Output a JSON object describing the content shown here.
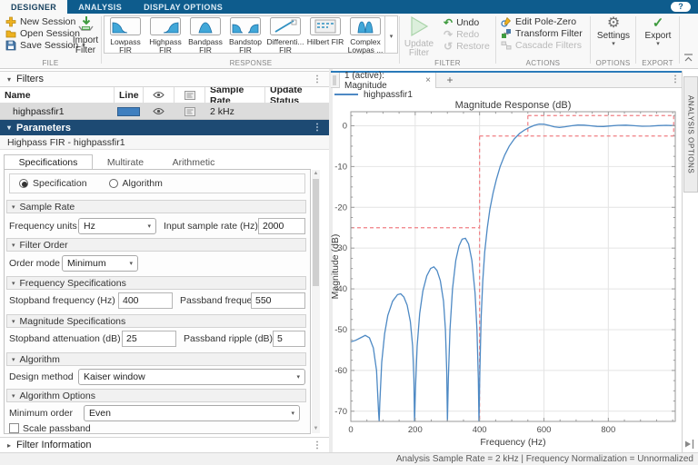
{
  "app": {
    "help_label": "?"
  },
  "menu_tabs": {
    "items": [
      "DESIGNER",
      "ANALYSIS",
      "DISPLAY OPTIONS"
    ],
    "active": "DESIGNER"
  },
  "ribbon": {
    "file": {
      "group_label": "FILE",
      "new_session": "New Session",
      "open_session": "Open Session",
      "save_session": "Save Session",
      "import_line1": "Import",
      "import_line2": "Filter"
    },
    "response": {
      "group_label": "RESPONSE",
      "items": [
        {
          "line1": "Lowpass",
          "line2": "FIR"
        },
        {
          "line1": "Highpass",
          "line2": "FIR"
        },
        {
          "line1": "Bandpass",
          "line2": "FIR"
        },
        {
          "line1": "Bandstop",
          "line2": "FIR"
        },
        {
          "line1": "Differenti...",
          "line2": "FIR"
        },
        {
          "line1": "Hilbert FIR",
          "line2": ""
        },
        {
          "line1": "Complex",
          "line2": "Lowpas ..."
        }
      ]
    },
    "filter": {
      "group_label": "FILTER",
      "update_line1": "Update",
      "update_line2": "Filter",
      "undo": "Undo",
      "redo": "Redo",
      "restore": "Restore"
    },
    "actions": {
      "group_label": "ACTIONS",
      "edit_pole_zero": "Edit Pole-Zero",
      "transform_filter": "Transform Filter",
      "cascade_filters": "Cascade Filters"
    },
    "options": {
      "group_label": "OPTIONS",
      "settings": "Settings"
    },
    "export": {
      "group_label": "EXPORT",
      "export": "Export"
    }
  },
  "filters_panel": {
    "title": "Filters",
    "columns": {
      "name": "Name",
      "line": "Line",
      "sample_rate": "Sample Rate",
      "update_status": "Update Status"
    },
    "row": {
      "name": "highpassfir1",
      "line_color": "#3f7fbf",
      "sample_rate": "2 kHz",
      "update_status": ""
    }
  },
  "parameters_panel": {
    "title": "Parameters",
    "subtitle": "Highpass FIR - highpassfir1",
    "tabs": [
      "Specifications",
      "Multirate",
      "Arithmetic"
    ],
    "active_tab": "Specifications",
    "design_radio": {
      "options": [
        "Specification",
        "Algorithm"
      ],
      "selected": "Specification"
    },
    "sample_rate": {
      "title": "Sample Rate",
      "frequency_units_label": "Frequency units",
      "frequency_units_value": "Hz",
      "input_sample_rate_label": "Input sample rate (Hz)",
      "input_sample_rate_value": "2000"
    },
    "filter_order": {
      "title": "Filter Order",
      "order_mode_label": "Order mode",
      "order_mode_value": "Minimum"
    },
    "frequency_specifications": {
      "title": "Frequency Specifications",
      "stopband_label": "Stopband frequency (Hz)",
      "stopband_value": "400",
      "passband_label": "Passband frequency (Hz)",
      "passband_value": "550"
    },
    "magnitude_specifications": {
      "title": "Magnitude Specifications",
      "stopband_attenuation_label": "Stopband attenuation (dB)",
      "stopband_attenuation_value": "25",
      "passband_ripple_label": "Passband ripple (dB)",
      "passband_ripple_value": "5"
    },
    "algorithm": {
      "title": "Algorithm",
      "design_method_label": "Design method",
      "design_method_value": "Kaiser window"
    },
    "algorithm_options": {
      "title": "Algorithm Options",
      "minimum_order_label": "Minimum order",
      "minimum_order_value": "Even",
      "scale_passband_label": "Scale passband",
      "scale_passband_checked": false
    },
    "filter_information": "Filter Information"
  },
  "document_area": {
    "tab_title": "1 (active): Magnitude",
    "close_label": "×",
    "add_tab_label": "+",
    "legend_label": "highpassfir1",
    "right_tab": "ANALYSIS OPTIONS"
  },
  "status_bar": {
    "text": "Analysis Sample Rate = 2 kHz | Frequency Normalization = Unnormalized"
  },
  "colors": {
    "accent_blue": "#0e5c8d",
    "panel_header_navy": "#1d4a73",
    "curve_blue": "#4d89c4",
    "mask_red": "#f07f84",
    "line_swatch": "#3f7fbf"
  },
  "chart_data": {
    "type": "line",
    "title": "Magnitude Response (dB)",
    "xlabel": "Frequency (Hz)",
    "ylabel": "Magnitude (dB)",
    "xlim": [
      0,
      1008
    ],
    "ylim": [
      -72.5,
      3.45
    ],
    "xticks": [
      0,
      200,
      400,
      600,
      800
    ],
    "yticks": [
      0,
      -10,
      -20,
      -30,
      -40,
      -50,
      -60,
      -70
    ],
    "grid": true,
    "legend_position": "top-left-above-axes",
    "legend": [
      "highpassfir1"
    ],
    "series": [
      {
        "name": "highpassfir1",
        "color": "#4d89c4",
        "points": [
          [
            0,
            -53
          ],
          [
            15,
            -52.6
          ],
          [
            30,
            -52
          ],
          [
            45,
            -51.4
          ],
          [
            58,
            -52
          ],
          [
            70,
            -54.5
          ],
          [
            80,
            -60
          ],
          [
            86,
            -70
          ],
          [
            88,
            -72.5
          ],
          [
            90,
            -68
          ],
          [
            96,
            -58
          ],
          [
            105,
            -51
          ],
          [
            115,
            -46.5
          ],
          [
            130,
            -43
          ],
          [
            145,
            -41.4
          ],
          [
            155,
            -41.2
          ],
          [
            165,
            -42
          ],
          [
            175,
            -44
          ],
          [
            185,
            -48
          ],
          [
            192,
            -54
          ],
          [
            196,
            -62
          ],
          [
            198,
            -72.5
          ],
          [
            201,
            -64
          ],
          [
            206,
            -54
          ],
          [
            214,
            -46
          ],
          [
            224,
            -40.5
          ],
          [
            236,
            -36.8
          ],
          [
            248,
            -35
          ],
          [
            258,
            -34.6
          ],
          [
            268,
            -35.5
          ],
          [
            278,
            -38
          ],
          [
            288,
            -43
          ],
          [
            294,
            -50
          ],
          [
            298,
            -60
          ],
          [
            300,
            -72.5
          ],
          [
            303,
            -62
          ],
          [
            308,
            -50
          ],
          [
            316,
            -40
          ],
          [
            326,
            -33
          ],
          [
            336,
            -29.5
          ],
          [
            346,
            -27.8
          ],
          [
            356,
            -27.6
          ],
          [
            366,
            -29
          ],
          [
            376,
            -33
          ],
          [
            386,
            -41
          ],
          [
            392,
            -50
          ],
          [
            396,
            -62
          ],
          [
            398,
            -72.5
          ],
          [
            401,
            -60
          ],
          [
            405,
            -47
          ],
          [
            410,
            -38
          ],
          [
            416,
            -31
          ],
          [
            424,
            -25
          ],
          [
            432,
            -20.5
          ],
          [
            442,
            -16.5
          ],
          [
            452,
            -13.2
          ],
          [
            464,
            -10
          ],
          [
            478,
            -7.2
          ],
          [
            492,
            -5
          ],
          [
            508,
            -3.2
          ],
          [
            524,
            -1.9
          ],
          [
            540,
            -1
          ],
          [
            556,
            -0.35
          ],
          [
            570,
            0.1
          ],
          [
            585,
            0.42
          ],
          [
            600,
            0.38
          ],
          [
            615,
            0.1
          ],
          [
            632,
            -0.25
          ],
          [
            648,
            -0.4
          ],
          [
            665,
            -0.25
          ],
          [
            685,
            0
          ],
          [
            705,
            0.18
          ],
          [
            725,
            0.15
          ],
          [
            745,
            0
          ],
          [
            765,
            -0.15
          ],
          [
            785,
            -0.18
          ],
          [
            805,
            -0.05
          ],
          [
            830,
            0.12
          ],
          [
            855,
            0.15
          ],
          [
            880,
            0.02
          ],
          [
            905,
            -0.12
          ],
          [
            930,
            -0.1
          ],
          [
            955,
            0.05
          ],
          [
            980,
            0.12
          ],
          [
            1000,
            0.05
          ],
          [
            1008,
            0
          ]
        ]
      }
    ],
    "mask": {
      "color": "#f07f84",
      "style": "dashed",
      "stopband_attenuation_db": -25,
      "passband_ripple_db": 2.5,
      "segments": [
        [
          0,
          -25,
          400,
          -25
        ],
        [
          400,
          -2.5,
          400,
          -72.5
        ],
        [
          400,
          -2.5,
          1003,
          -2.5
        ],
        [
          550,
          2.5,
          550,
          -2.5
        ],
        [
          550,
          2.5,
          1003,
          2.5
        ],
        [
          1003,
          2.5,
          1003,
          -2.5
        ]
      ]
    }
  }
}
